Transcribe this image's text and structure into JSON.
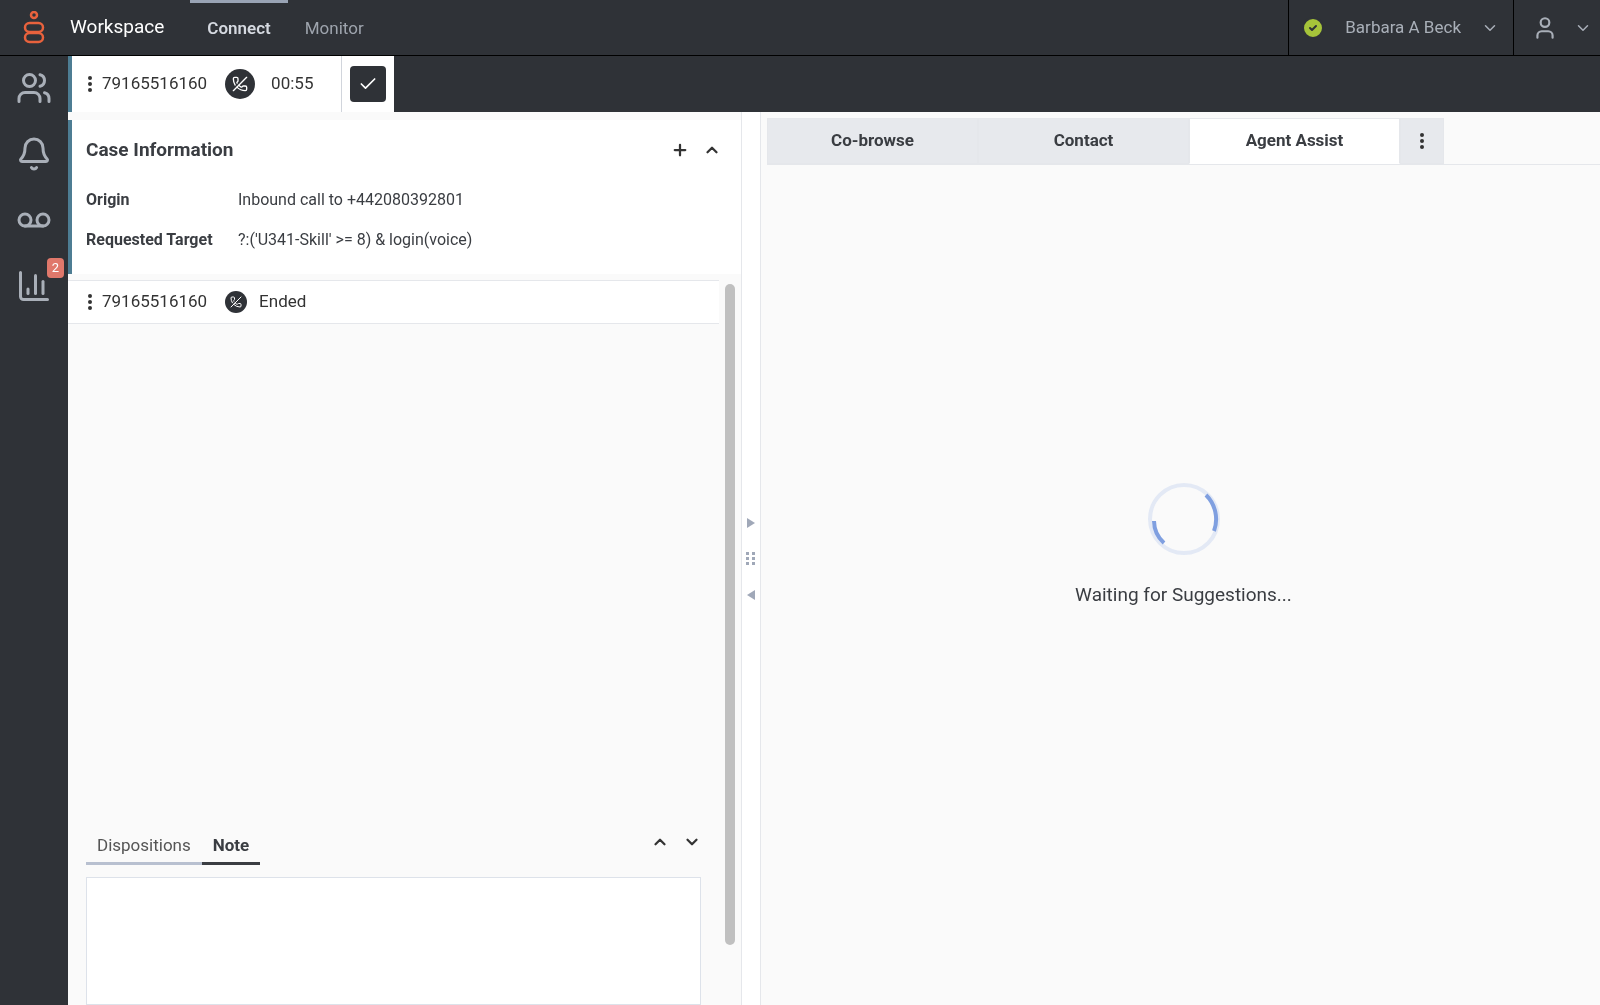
{
  "app": {
    "title": "Workspace"
  },
  "nav_tabs": [
    {
      "label": "Connect",
      "selected": true
    },
    {
      "label": "Monitor",
      "selected": false
    }
  ],
  "user": {
    "name": "Barbara A Beck"
  },
  "sidebar": {
    "items": [
      {
        "kind": "team"
      },
      {
        "kind": "bell"
      },
      {
        "kind": "voicemail"
      },
      {
        "kind": "stats",
        "badge": "2"
      }
    ]
  },
  "interaction_bar": {
    "number": "79165516160",
    "timer": "00:55"
  },
  "case_info": {
    "title": "Case Information",
    "fields": [
      {
        "label": "Origin",
        "value": "Inbound call to +442080392801"
      },
      {
        "label": "Requested Target",
        "value": "?:('U341-Skill' >= 8) & login(voice)"
      }
    ]
  },
  "call_row": {
    "number": "79165516160",
    "status": "Ended"
  },
  "bottom_tabs": [
    {
      "label": "Dispositions",
      "selected": false
    },
    {
      "label": "Note",
      "selected": true
    }
  ],
  "right_tabs": [
    {
      "label": "Co-browse",
      "selected": false
    },
    {
      "label": "Contact",
      "selected": false
    },
    {
      "label": "Agent Assist",
      "selected": true
    }
  ],
  "assist": {
    "message": "Waiting for Suggestions..."
  }
}
